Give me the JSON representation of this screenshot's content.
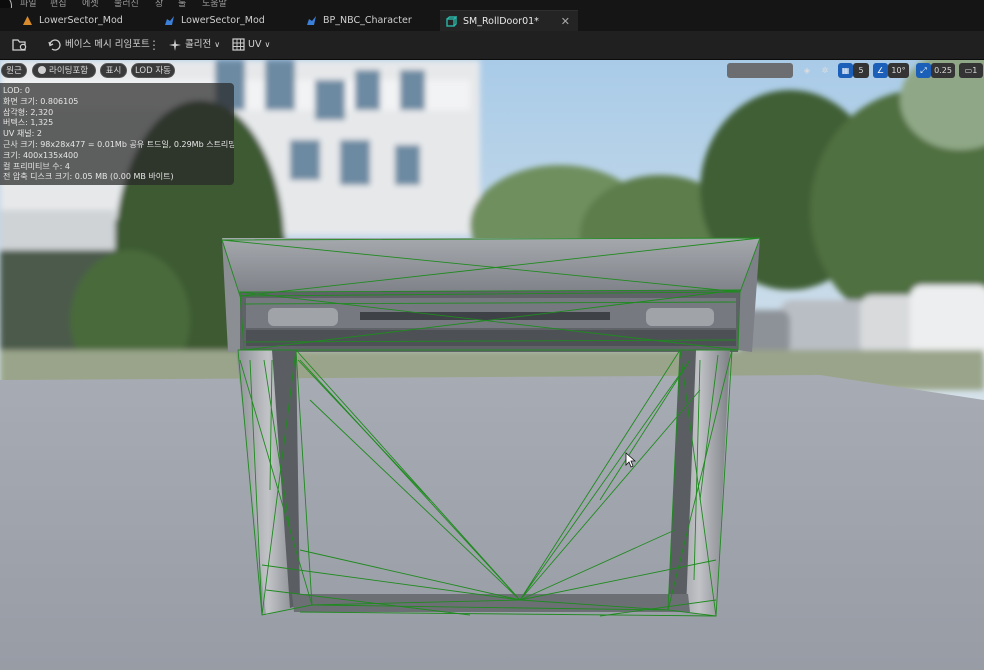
{
  "menu": [
    "파일",
    "편집",
    "에셋",
    "불러진",
    "창",
    "툴",
    "도움말"
  ],
  "tabs": [
    {
      "label": "LowerSector_Mod",
      "icon": "level-icon",
      "active": false
    },
    {
      "label": "LowerSector_Mod",
      "icon": "blueprint-icon",
      "active": false
    },
    {
      "label": "BP_NBC_Character",
      "icon": "blueprint-icon",
      "active": false
    },
    {
      "label": "SM_RollDoor01*",
      "icon": "static-mesh-icon",
      "active": true
    }
  ],
  "toolbar": {
    "reimport_label": "베이스 메시 리임포트",
    "collision_label": "콜리전",
    "uv_label": "UV"
  },
  "viewport": {
    "perspective_label": "원근",
    "lit_label": "라이팅포함",
    "show_label": "표시",
    "lod_label": "LOD 자동",
    "grid_value": "5",
    "rotation_value": "10°",
    "scale_value": "0.25",
    "camera_value": "1"
  },
  "stats": [
    "LOD: 0",
    "화면 크기: 0.806105",
    "삼각형: 2,320",
    "버텍스: 1,325",
    "UV 채널: 2",
    "근사 크기: 98x28x477 = 0.01Mb 공유 트드일, 0.29Mb 스트리밍됨",
    "크기: 400x135x400",
    "컬 프리미티브 수: 4",
    "전 압축 디스크 크기: 0.05 MB (0.00 MB 바이트)"
  ],
  "colors": {
    "accent": "#1b5fb8",
    "active_tab_icon": "#2ab5a6",
    "wireframe": "#1f8a1f"
  }
}
